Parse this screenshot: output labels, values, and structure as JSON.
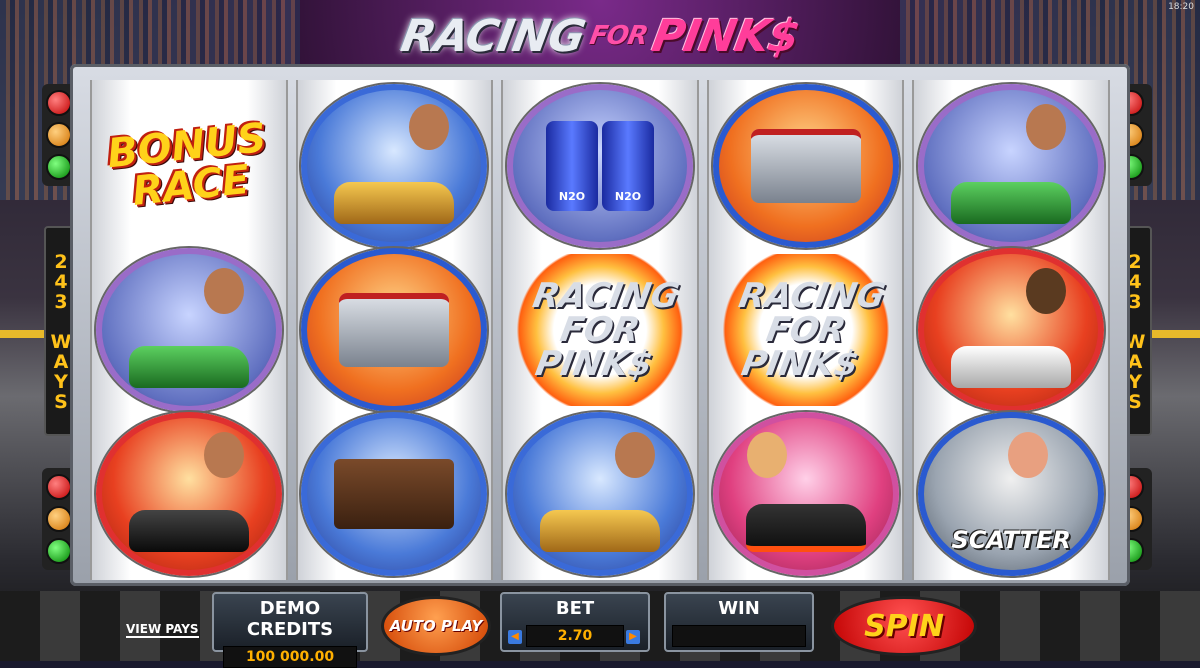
{
  "game": {
    "title_part1": "RACING",
    "title_part2": "FOR",
    "title_part3": "PINK$",
    "clock": "18:20"
  },
  "side": {
    "ways_left": "243 WAYS",
    "ways_right": "243 WAYS"
  },
  "reels": [
    [
      {
        "symbol": "bonus-race",
        "label": "BONUS RACE"
      },
      {
        "symbol": "green-car-driver",
        "label": ""
      },
      {
        "symbol": "black-car-driver",
        "label": ""
      }
    ],
    [
      {
        "symbol": "gold-lowrider-cowboy",
        "label": ""
      },
      {
        "symbol": "engine",
        "label": ""
      },
      {
        "symbol": "money-briefcase",
        "label": ""
      }
    ],
    [
      {
        "symbol": "nitro-tanks",
        "label": "N2O"
      },
      {
        "symbol": "racing-for-pinks-wild",
        "label": "RACING FOR PINK$"
      },
      {
        "symbol": "gold-lowrider-cowboy",
        "label": ""
      }
    ],
    [
      {
        "symbol": "engine",
        "label": ""
      },
      {
        "symbol": "racing-for-pinks-wild",
        "label": "RACING FOR PINK$"
      },
      {
        "symbol": "hotrod-woman",
        "label": ""
      }
    ],
    [
      {
        "symbol": "green-car-driver",
        "label": ""
      },
      {
        "symbol": "muscle-car-driver",
        "label": ""
      },
      {
        "symbol": "scatter-woman",
        "label": "SCATTER"
      }
    ]
  ],
  "controls": {
    "view_pays": "VIEW PAYS",
    "credits_label": "DEMO CREDITS",
    "credits_value": "100 000.00",
    "autoplay_label": "AUTO PLAY",
    "bet_label": "BET",
    "bet_value": "2.70",
    "win_label": "WIN",
    "win_value": "",
    "spin_label": "SPIN"
  },
  "colors": {
    "accent_pink": "#ff3d9a",
    "credit_text": "#ffb000",
    "ways_text": "#ffc21a",
    "spin_button": "#c00000"
  }
}
